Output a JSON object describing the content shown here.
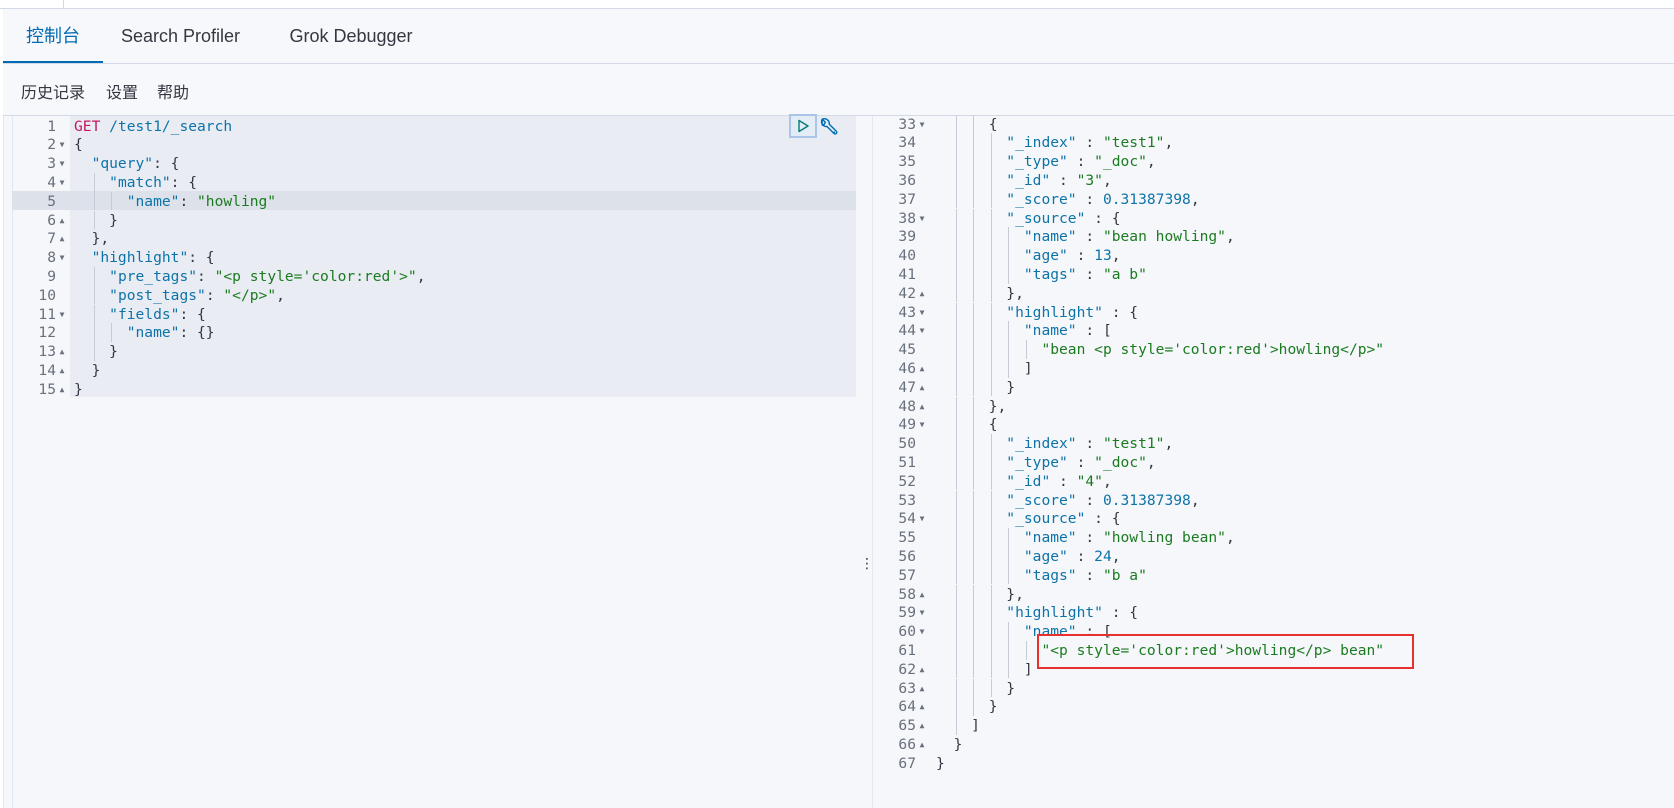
{
  "tabs": [
    {
      "label": "控制台",
      "active": true
    },
    {
      "label": "Search Profiler",
      "active": false
    },
    {
      "label": "Grok Debugger",
      "active": false
    }
  ],
  "submenu": [
    {
      "label": "历史记录"
    },
    {
      "label": "设置"
    },
    {
      "label": "帮助"
    }
  ],
  "colors": {
    "accent": "#006bb4",
    "key": "#0e73a8",
    "string": "#1b7b20",
    "method": "#c3185f",
    "annotation_box": "#e8302f"
  },
  "request_editor": {
    "active_line": 5,
    "run_button_icon": "play-icon",
    "settings_icon": "wrench-icon",
    "lines": [
      {
        "n": "1",
        "fold": "",
        "indent": 0,
        "tokens": [
          [
            "m",
            "GET"
          ],
          [
            "p",
            " "
          ],
          [
            "n",
            "/test1/_search"
          ]
        ]
      },
      {
        "n": "2",
        "fold": "down",
        "indent": 0,
        "tokens": [
          [
            "p",
            "{"
          ]
        ]
      },
      {
        "n": "3",
        "fold": "down",
        "indent": 1,
        "tokens": [
          [
            "k",
            "\"query\""
          ],
          [
            "p",
            ": {"
          ]
        ]
      },
      {
        "n": "4",
        "fold": "down",
        "indent": 2,
        "tokens": [
          [
            "k",
            "\"match\""
          ],
          [
            "p",
            ": {"
          ]
        ]
      },
      {
        "n": "5",
        "fold": "",
        "indent": 3,
        "tokens": [
          [
            "k",
            "\"name\""
          ],
          [
            "p",
            ": "
          ],
          [
            "s",
            "\"howling\""
          ]
        ]
      },
      {
        "n": "6",
        "fold": "up",
        "indent": 2,
        "tokens": [
          [
            "p",
            "}"
          ]
        ]
      },
      {
        "n": "7",
        "fold": "up",
        "indent": 1,
        "tokens": [
          [
            "p",
            "},"
          ]
        ]
      },
      {
        "n": "8",
        "fold": "down",
        "indent": 1,
        "tokens": [
          [
            "k",
            "\"highlight\""
          ],
          [
            "p",
            ": {"
          ]
        ]
      },
      {
        "n": "9",
        "fold": "",
        "indent": 2,
        "tokens": [
          [
            "k",
            "\"pre_tags\""
          ],
          [
            "p",
            ": "
          ],
          [
            "s",
            "\"<p style='color:red'>\""
          ],
          [
            "p",
            ","
          ]
        ]
      },
      {
        "n": "10",
        "fold": "",
        "indent": 2,
        "tokens": [
          [
            "k",
            "\"post_tags\""
          ],
          [
            "p",
            ": "
          ],
          [
            "s",
            "\"</p>\""
          ],
          [
            "p",
            ","
          ]
        ]
      },
      {
        "n": "11",
        "fold": "down",
        "indent": 2,
        "tokens": [
          [
            "k",
            "\"fields\""
          ],
          [
            "p",
            ": {"
          ]
        ]
      },
      {
        "n": "12",
        "fold": "",
        "indent": 3,
        "tokens": [
          [
            "k",
            "\"name\""
          ],
          [
            "p",
            ": {}"
          ]
        ]
      },
      {
        "n": "13",
        "fold": "up",
        "indent": 2,
        "tokens": [
          [
            "p",
            "}"
          ]
        ]
      },
      {
        "n": "14",
        "fold": "up",
        "indent": 1,
        "tokens": [
          [
            "p",
            "}"
          ]
        ]
      },
      {
        "n": "15",
        "fold": "up",
        "indent": 0,
        "tokens": [
          [
            "p",
            "}"
          ]
        ]
      }
    ]
  },
  "response_viewer": {
    "lines": [
      {
        "n": "33",
        "fold": "down",
        "indent": 3,
        "tokens": [
          [
            "p",
            "{"
          ]
        ]
      },
      {
        "n": "34",
        "fold": "",
        "indent": 4,
        "tokens": [
          [
            "k",
            "\"_index\""
          ],
          [
            "p",
            " : "
          ],
          [
            "s",
            "\"test1\""
          ],
          [
            "p",
            ","
          ]
        ]
      },
      {
        "n": "35",
        "fold": "",
        "indent": 4,
        "tokens": [
          [
            "k",
            "\"_type\""
          ],
          [
            "p",
            " : "
          ],
          [
            "s",
            "\"_doc\""
          ],
          [
            "p",
            ","
          ]
        ]
      },
      {
        "n": "36",
        "fold": "",
        "indent": 4,
        "tokens": [
          [
            "k",
            "\"_id\""
          ],
          [
            "p",
            " : "
          ],
          [
            "s",
            "\"3\""
          ],
          [
            "p",
            ","
          ]
        ]
      },
      {
        "n": "37",
        "fold": "",
        "indent": 4,
        "tokens": [
          [
            "k",
            "\"_score\""
          ],
          [
            "p",
            " : "
          ],
          [
            "n",
            "0.31387398"
          ],
          [
            "p",
            ","
          ]
        ]
      },
      {
        "n": "38",
        "fold": "down",
        "indent": 4,
        "tokens": [
          [
            "k",
            "\"_source\""
          ],
          [
            "p",
            " : {"
          ]
        ]
      },
      {
        "n": "39",
        "fold": "",
        "indent": 5,
        "tokens": [
          [
            "k",
            "\"name\""
          ],
          [
            "p",
            " : "
          ],
          [
            "s",
            "\"bean howling\""
          ],
          [
            "p",
            ","
          ]
        ]
      },
      {
        "n": "40",
        "fold": "",
        "indent": 5,
        "tokens": [
          [
            "k",
            "\"age\""
          ],
          [
            "p",
            " : "
          ],
          [
            "n",
            "13"
          ],
          [
            "p",
            ","
          ]
        ]
      },
      {
        "n": "41",
        "fold": "",
        "indent": 5,
        "tokens": [
          [
            "k",
            "\"tags\""
          ],
          [
            "p",
            " : "
          ],
          [
            "s",
            "\"a b\""
          ]
        ]
      },
      {
        "n": "42",
        "fold": "up",
        "indent": 4,
        "tokens": [
          [
            "p",
            "},"
          ]
        ]
      },
      {
        "n": "43",
        "fold": "down",
        "indent": 4,
        "tokens": [
          [
            "k",
            "\"highlight\""
          ],
          [
            "p",
            " : {"
          ]
        ]
      },
      {
        "n": "44",
        "fold": "down",
        "indent": 5,
        "tokens": [
          [
            "k",
            "\"name\""
          ],
          [
            "p",
            " : ["
          ]
        ]
      },
      {
        "n": "45",
        "fold": "",
        "indent": 6,
        "tokens": [
          [
            "s",
            "\"bean <p style='color:red'>howling</p>\""
          ]
        ]
      },
      {
        "n": "46",
        "fold": "up",
        "indent": 5,
        "tokens": [
          [
            "p",
            "]"
          ]
        ]
      },
      {
        "n": "47",
        "fold": "up",
        "indent": 4,
        "tokens": [
          [
            "p",
            "}"
          ]
        ]
      },
      {
        "n": "48",
        "fold": "up",
        "indent": 3,
        "tokens": [
          [
            "p",
            "},"
          ]
        ]
      },
      {
        "n": "49",
        "fold": "down",
        "indent": 3,
        "tokens": [
          [
            "p",
            "{"
          ]
        ]
      },
      {
        "n": "50",
        "fold": "",
        "indent": 4,
        "tokens": [
          [
            "k",
            "\"_index\""
          ],
          [
            "p",
            " : "
          ],
          [
            "s",
            "\"test1\""
          ],
          [
            "p",
            ","
          ]
        ]
      },
      {
        "n": "51",
        "fold": "",
        "indent": 4,
        "tokens": [
          [
            "k",
            "\"_type\""
          ],
          [
            "p",
            " : "
          ],
          [
            "s",
            "\"_doc\""
          ],
          [
            "p",
            ","
          ]
        ]
      },
      {
        "n": "52",
        "fold": "",
        "indent": 4,
        "tokens": [
          [
            "k",
            "\"_id\""
          ],
          [
            "p",
            " : "
          ],
          [
            "s",
            "\"4\""
          ],
          [
            "p",
            ","
          ]
        ]
      },
      {
        "n": "53",
        "fold": "",
        "indent": 4,
        "tokens": [
          [
            "k",
            "\"_score\""
          ],
          [
            "p",
            " : "
          ],
          [
            "n",
            "0.31387398"
          ],
          [
            "p",
            ","
          ]
        ]
      },
      {
        "n": "54",
        "fold": "down",
        "indent": 4,
        "tokens": [
          [
            "k",
            "\"_source\""
          ],
          [
            "p",
            " : {"
          ]
        ]
      },
      {
        "n": "55",
        "fold": "",
        "indent": 5,
        "tokens": [
          [
            "k",
            "\"name\""
          ],
          [
            "p",
            " : "
          ],
          [
            "s",
            "\"howling bean\""
          ],
          [
            "p",
            ","
          ]
        ]
      },
      {
        "n": "56",
        "fold": "",
        "indent": 5,
        "tokens": [
          [
            "k",
            "\"age\""
          ],
          [
            "p",
            " : "
          ],
          [
            "n",
            "24"
          ],
          [
            "p",
            ","
          ]
        ]
      },
      {
        "n": "57",
        "fold": "",
        "indent": 5,
        "tokens": [
          [
            "k",
            "\"tags\""
          ],
          [
            "p",
            " : "
          ],
          [
            "s",
            "\"b a\""
          ]
        ]
      },
      {
        "n": "58",
        "fold": "up",
        "indent": 4,
        "tokens": [
          [
            "p",
            "},"
          ]
        ]
      },
      {
        "n": "59",
        "fold": "down",
        "indent": 4,
        "tokens": [
          [
            "k",
            "\"highlight\""
          ],
          [
            "p",
            " : {"
          ]
        ]
      },
      {
        "n": "60",
        "fold": "down",
        "indent": 5,
        "tokens": [
          [
            "k",
            "\"name\""
          ],
          [
            "p",
            " : ["
          ]
        ]
      },
      {
        "n": "61",
        "fold": "",
        "indent": 6,
        "tokens": [
          [
            "s",
            "\"<p style='color:red'>howling</p> bean\""
          ]
        ]
      },
      {
        "n": "62",
        "fold": "up",
        "indent": 5,
        "tokens": [
          [
            "p",
            "]"
          ]
        ]
      },
      {
        "n": "63",
        "fold": "up",
        "indent": 4,
        "tokens": [
          [
            "p",
            "}"
          ]
        ]
      },
      {
        "n": "64",
        "fold": "up",
        "indent": 3,
        "tokens": [
          [
            "p",
            "}"
          ]
        ]
      },
      {
        "n": "65",
        "fold": "up",
        "indent": 2,
        "tokens": [
          [
            "p",
            "]"
          ]
        ]
      },
      {
        "n": "66",
        "fold": "up",
        "indent": 1,
        "tokens": [
          [
            "p",
            "}"
          ]
        ]
      },
      {
        "n": "67",
        "fold": "",
        "indent": 0,
        "tokens": [
          [
            "p",
            "}"
          ]
        ]
      }
    ],
    "annotated_line": "61"
  }
}
